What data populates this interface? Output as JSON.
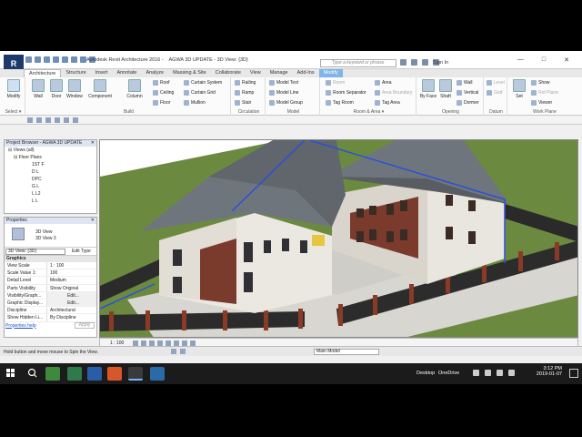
{
  "window": {
    "app_logo": "R",
    "title": "Autodesk Revit Architecture 2016 -",
    "document_title": "AGWA 3D UPDATE - 3D View: {3D}",
    "search_placeholder": "Type a keyword or phrase",
    "signin_label": "Sign In",
    "controls": [
      "—",
      "□",
      "✕"
    ]
  },
  "ribbon_tabs": [
    "Architecture",
    "Structure",
    "Insert",
    "Annotate",
    "Analyze",
    "Massing & Site",
    "Collaborate",
    "View",
    "Manage",
    "Add-Ins",
    "Modify"
  ],
  "ribbon": {
    "select": {
      "modify_label": "Modify",
      "group_label": "Select ▾"
    },
    "build": {
      "group_label": "Build",
      "big": [
        "Wall",
        "Door",
        "Window",
        "Component",
        "Column"
      ],
      "small": [
        "Roof",
        "Ceiling",
        "Floor",
        "Curtain System",
        "Curtain Grid",
        "Mullion"
      ]
    },
    "circulation": {
      "group_label": "Circulation",
      "items": [
        "Railing",
        "Ramp",
        "Stair"
      ]
    },
    "model": {
      "group_label": "Model",
      "items": [
        "Model Text",
        "Model Line",
        "Model Group"
      ]
    },
    "room_area": {
      "group_label": "Room & Area ▾",
      "items": [
        "Room",
        "Room Separator",
        "Tag Room",
        "Area",
        "Area Boundary",
        "Tag Area"
      ]
    },
    "opening": {
      "group_label": "Opening",
      "big": [
        "By Face",
        "Shaft"
      ],
      "small": [
        "Wall",
        "Vertical",
        "Dormer"
      ]
    },
    "datum": {
      "group_label": "Datum",
      "items": [
        "Level",
        "Grid"
      ]
    },
    "work_plane": {
      "group_label": "Work Plane",
      "big": "Set",
      "items": [
        "Show",
        "Ref Plane",
        "Viewer"
      ]
    }
  },
  "project_browser": {
    "title": "Project Browser - AGWA 3D UPDATE",
    "items": [
      "Views (all)",
      "Floor Plans",
      "1ST F",
      "D L",
      "DPC",
      "G L",
      "L L2",
      "L L"
    ]
  },
  "properties": {
    "title": "Properties",
    "type_name": "3D View",
    "type_sub": "3D View 3",
    "selector": "3D View: {3D}",
    "edit_type": "Edit Type",
    "group": "Graphics",
    "rows": [
      {
        "k": "View Scale",
        "v": "1 : 100"
      },
      {
        "k": "Scale Value  1:",
        "v": "100"
      },
      {
        "k": "Detail Level",
        "v": "Medium"
      },
      {
        "k": "Parts Visibility",
        "v": "Show Original"
      },
      {
        "k": "Visibility/Graph...",
        "v": "Edit..."
      },
      {
        "k": "Graphic Display...",
        "v": "Edit..."
      },
      {
        "k": "Discipline",
        "v": "Architectural"
      },
      {
        "k": "Show Hidden Li...",
        "v": "By Discipline"
      }
    ],
    "help_link": "Properties help",
    "apply": "Apply"
  },
  "view_controls": {
    "scale": "1 : 100"
  },
  "status": {
    "message": "Hold button and move mouse to Spin the View.",
    "workset": "Main Model"
  },
  "taskbar": {
    "desktop": "Desktop",
    "onedrive": "OneDrive",
    "time": "3:12 PM",
    "date": "2019-01-07"
  },
  "colors": {
    "ribbon_active_tab": "#ffffff",
    "modify_tab": "#7fb5e8",
    "roof": "#6f757c",
    "brick": "#7a3b2c",
    "wall_white": "#e9e6e0",
    "ground": "#6b8a3f",
    "selection_outline": "#2a50d8"
  }
}
